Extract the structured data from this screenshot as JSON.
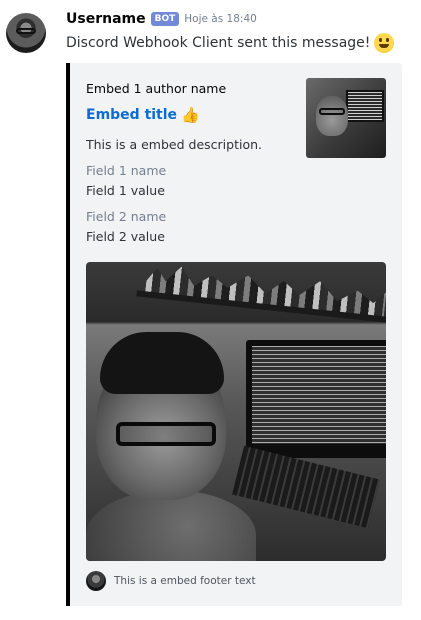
{
  "message": {
    "username": "Username",
    "bot_tag": "BOT",
    "timestamp": "Hoje às 18:40",
    "content": "Discord Webhook Client sent this message!",
    "content_emoji": "smiley-emoji"
  },
  "embed": {
    "accent_color": "#000000",
    "author_name": "Embed 1 author name",
    "title": "Embed title",
    "title_emoji": "👍",
    "description": "This is a embed description.",
    "fields": [
      {
        "name": "Field 1 name",
        "value": "Field 1 value"
      },
      {
        "name": "Field 2 name",
        "value": "Field 2 value"
      }
    ],
    "footer_text": "This is a embed footer text"
  },
  "colors": {
    "title_link": "#0b6cd6",
    "bot_tag": "#7289da",
    "embed_background": "#f2f3f5"
  }
}
